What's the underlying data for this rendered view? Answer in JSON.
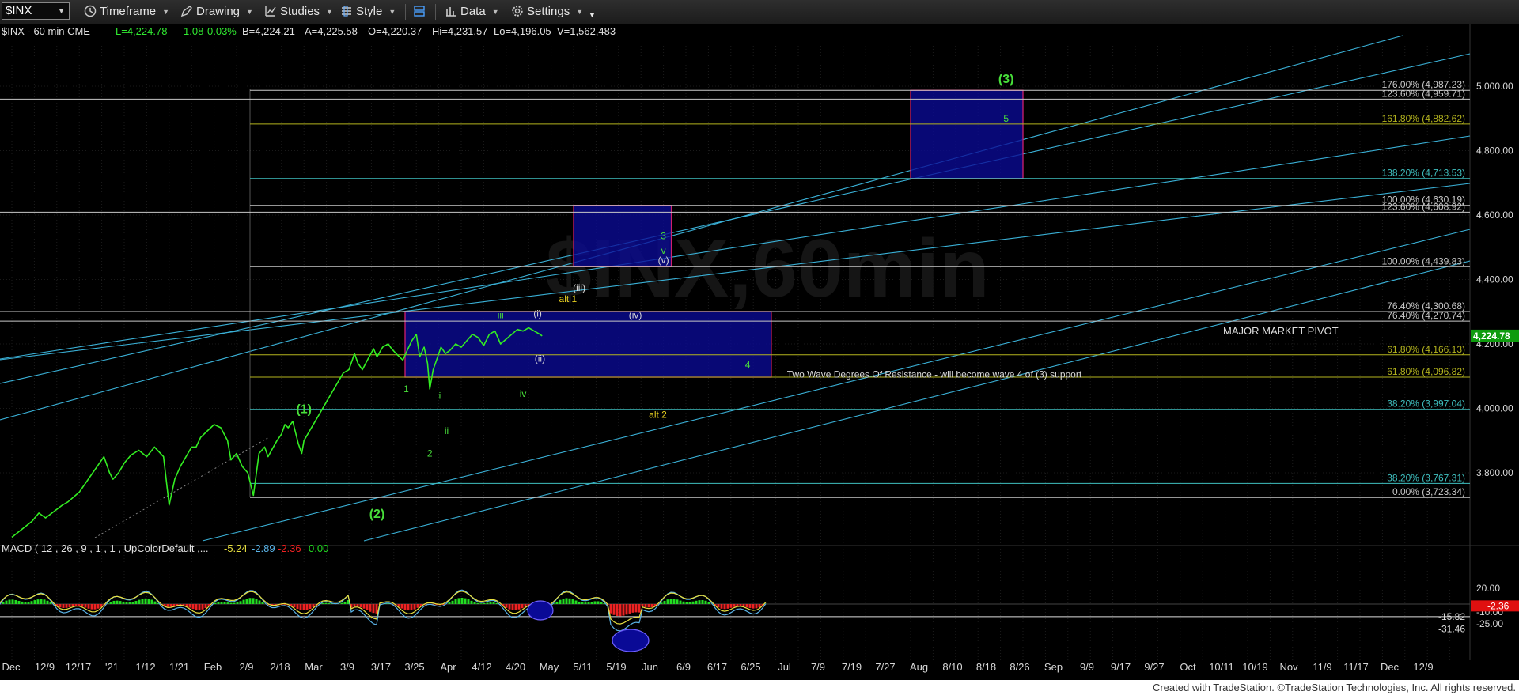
{
  "toolbar": {
    "symbol": "$INX",
    "timeframe": "Timeframe",
    "drawing": "Drawing",
    "studies": "Studies",
    "style": "Style",
    "data": "Data",
    "settings": "Settings"
  },
  "header": {
    "symbol": "$INX - 60 min  CME",
    "last": "L=4,224.78",
    "change": "1.08",
    "pct": "0.03%",
    "bid": "B=4,224.21",
    "ask": "A=4,225.58",
    "open": "O=4,220.37",
    "high": "Hi=4,231.57",
    "low": "Lo=4,196.05",
    "volume": "V=1,562,483"
  },
  "watermark": "$INX,60min",
  "colors": {
    "price": "#33ee22",
    "fib_white": "#c8c8c8",
    "fib_olive": "#b4b41e",
    "fib_teal": "#3fbfbf",
    "channel": "#3ab0d6",
    "box_fill": "#0a0a96",
    "box_border": "#d0206e",
    "wave_green": "#48e03a",
    "wave_yellow": "#e8d020",
    "wave_white": "#d8d8d8",
    "macd_line": "#5ab4e8",
    "signal_line": "#e8e040",
    "hist_up": "#22dd22",
    "hist_down": "#ee2222",
    "last_price_tag": "#0e9c0e",
    "macd_tag": "#e01010"
  },
  "chart_data": {
    "type": "line",
    "title": "$INX - 60 min",
    "y_axis": {
      "range": [
        3500,
        5200
      ],
      "ticks": [
        "5,000.00",
        "4,800.00",
        "4,600.00",
        "4,400.00",
        "4,200.00",
        "4,000.00",
        "3,800.00"
      ],
      "tick_values": [
        5000,
        4800,
        4600,
        4400,
        4200,
        4000,
        3800
      ]
    },
    "last_price": "4,224.78",
    "x_axis_labels": [
      "Dec",
      "12/9",
      "12/17",
      "'21",
      "1/12",
      "1/21",
      "Feb",
      "2/9",
      "2/18",
      "Mar",
      "3/9",
      "3/17",
      "3/25",
      "Apr",
      "4/12",
      "4/20",
      "May",
      "5/11",
      "5/19",
      "Jun",
      "6/9",
      "6/17",
      "6/25",
      "Jul",
      "7/9",
      "7/19",
      "7/27",
      "Aug",
      "8/10",
      "8/18",
      "8/26",
      "Sep",
      "9/9",
      "9/17",
      "9/27",
      "Oct",
      "10/11",
      "10/19",
      "Nov",
      "11/9",
      "11/17",
      "Dec",
      "12/9"
    ],
    "price_series": {
      "name": "$INX",
      "x": [
        0,
        0.18,
        0.24,
        0.3,
        0.45,
        0.5,
        0.6,
        0.72,
        0.82,
        0.87,
        0.9,
        0.95,
        1.0,
        1.06,
        1.13,
        1.2,
        1.27,
        1.35,
        1.4,
        1.45,
        1.5,
        1.55,
        1.6,
        1.64,
        1.68,
        1.74,
        1.8,
        1.86,
        1.92,
        1.95,
        2.0,
        2.05,
        2.1,
        2.15,
        2.2,
        2.25,
        2.28,
        2.32,
        2.36,
        2.4,
        2.43,
        2.46,
        2.5,
        2.55,
        2.58,
        2.6,
        2.65,
        2.7,
        2.75,
        2.8,
        2.85,
        2.9,
        2.95,
        3.0,
        3.05,
        3.08,
        3.12,
        3.18,
        3.22,
        3.25,
        3.3,
        3.35,
        3.38,
        3.42,
        3.48,
        3.52,
        3.56,
        3.6,
        3.63,
        3.67,
        3.7,
        3.72,
        3.75,
        3.78,
        3.82,
        3.86,
        3.9,
        3.95,
        4.0,
        4.05,
        4.1,
        4.15,
        4.2,
        4.25,
        4.3,
        4.35,
        4.4,
        4.45,
        4.5,
        4.55,
        4.6,
        4.65,
        4.7,
        4.72
      ],
      "y": [
        3600,
        3650,
        3675,
        3660,
        3700,
        3710,
        3740,
        3800,
        3850,
        3800,
        3780,
        3800,
        3830,
        3855,
        3870,
        3850,
        3880,
        3850,
        3700,
        3780,
        3820,
        3850,
        3880,
        3880,
        3910,
        3930,
        3950,
        3940,
        3900,
        3840,
        3860,
        3820,
        3800,
        3730,
        3860,
        3880,
        3850,
        3875,
        3900,
        3920,
        3950,
        3940,
        3960,
        3890,
        3860,
        3900,
        3930,
        3960,
        3990,
        4020,
        4050,
        4080,
        4110,
        4120,
        4170,
        4140,
        4120,
        4160,
        4185,
        4160,
        4190,
        4200,
        4185,
        4170,
        4150,
        4180,
        4210,
        4230,
        4160,
        4190,
        4140,
        4060,
        4120,
        4150,
        4190,
        4170,
        4180,
        4200,
        4190,
        4210,
        4230,
        4220,
        4195,
        4230,
        4240,
        4200,
        4215,
        4230,
        4245,
        4240,
        4250,
        4240,
        4230,
        4224.78
      ]
    },
    "fib_levels": [
      {
        "label": "176.00% (4,987.23)",
        "value": 4987.23,
        "color": "white"
      },
      {
        "label": "123.60% (4,959.71)",
        "value": 4959.71,
        "color": "white"
      },
      {
        "label": "161.80% (4,882.62)",
        "value": 4882.62,
        "color": "olive"
      },
      {
        "label": "138.20% (4,713.53)",
        "value": 4713.53,
        "color": "teal"
      },
      {
        "label": "100.00% (4,630.19)",
        "value": 4630.19,
        "color": "white"
      },
      {
        "label": "123.60% (4,608.92)",
        "value": 4608.92,
        "color": "white"
      },
      {
        "label": "100.00% (4,439.83)",
        "value": 4439.83,
        "color": "white"
      },
      {
        "label": "76.40% (4,300.68)",
        "value": 4300.68,
        "color": "white"
      },
      {
        "label": "76.40% (4,270.74)",
        "value": 4270.74,
        "color": "white"
      },
      {
        "label": "61.80% (4,166.13)",
        "value": 4166.13,
        "color": "olive"
      },
      {
        "label": "61.80% (4,096.82)",
        "value": 4096.82,
        "color": "olive"
      },
      {
        "label": "38.20% (3,997.04)",
        "value": 3997.04,
        "color": "teal"
      },
      {
        "label": "38.20% (3,767.31)",
        "value": 3767.31,
        "color": "teal"
      },
      {
        "label": "0.00% (3,723.34)",
        "value": 3723.34,
        "color": "white"
      }
    ],
    "zones": [
      {
        "label": "MAJOR MARKET PIVOT",
        "x": [
          3.5,
          6.76
        ],
        "y": [
          4096.82,
          4300.68
        ]
      },
      {
        "label": "",
        "x": [
          5.0,
          5.87
        ],
        "y": [
          4439.83,
          4630.19
        ]
      },
      {
        "label": "",
        "x": [
          8.0,
          9.0
        ],
        "y": [
          4713.53,
          4987.23
        ]
      }
    ],
    "annotations": [
      {
        "text": "(1)",
        "x": 2.6,
        "y": 3985,
        "color": "green",
        "size": "big"
      },
      {
        "text": "(2)",
        "x": 3.25,
        "y": 3660,
        "color": "green",
        "size": "big"
      },
      {
        "text": "(3)",
        "x": 8.85,
        "y": 5010,
        "color": "green",
        "size": "big"
      },
      {
        "text": "1",
        "x": 3.51,
        "y": 4050,
        "color": "green"
      },
      {
        "text": "2",
        "x": 3.72,
        "y": 3850,
        "color": "green"
      },
      {
        "text": "i",
        "x": 3.81,
        "y": 4030,
        "color": "green"
      },
      {
        "text": "ii",
        "x": 3.87,
        "y": 3920,
        "color": "green"
      },
      {
        "text": "iii",
        "x": 4.35,
        "y": 4280,
        "color": "green"
      },
      {
        "text": "iv",
        "x": 4.55,
        "y": 4035,
        "color": "green"
      },
      {
        "text": "4",
        "x": 6.55,
        "y": 4125,
        "color": "green"
      },
      {
        "text": "3",
        "x": 5.8,
        "y": 4525,
        "color": "green"
      },
      {
        "text": "v",
        "x": 5.8,
        "y": 4480,
        "color": "green"
      },
      {
        "text": "5",
        "x": 8.85,
        "y": 4890,
        "color": "green"
      },
      {
        "text": "(i)",
        "x": 4.68,
        "y": 4285,
        "color": "white"
      },
      {
        "text": "(ii)",
        "x": 4.7,
        "y": 4145,
        "color": "white"
      },
      {
        "text": "(iii)",
        "x": 5.05,
        "y": 4365,
        "color": "white"
      },
      {
        "text": "(iv)",
        "x": 5.55,
        "y": 4280,
        "color": "white"
      },
      {
        "text": "(v)",
        "x": 5.8,
        "y": 4450,
        "color": "white"
      },
      {
        "text": "alt 1",
        "x": 4.95,
        "y": 4330,
        "color": "yellow"
      },
      {
        "text": "alt 2",
        "x": 5.75,
        "y": 3970,
        "color": "yellow"
      },
      {
        "text": "Two Wave Degrees Of Resistance - will become wave 4 of (3) support",
        "x": 6.9,
        "y": 4096,
        "color": "white"
      }
    ],
    "macd": {
      "label": "MACD ( 12 , 26 , 9 , 1 , 1 , UpColorDefault ,...",
      "values": [
        "-5.24",
        "-2.89",
        "-2.36",
        "0.00"
      ],
      "y_ticks": [
        "20.00",
        "-10.00",
        "-25.00"
      ],
      "tick_values": [
        20,
        -10,
        -25
      ],
      "marks": [
        "-15.82",
        "-31.46"
      ],
      "mark_values": [
        -15.82,
        -31.46
      ],
      "current_tag": "-2.36"
    }
  },
  "footer": "Created with TradeStation. ©TradeStation Technologies, Inc. All rights reserved."
}
